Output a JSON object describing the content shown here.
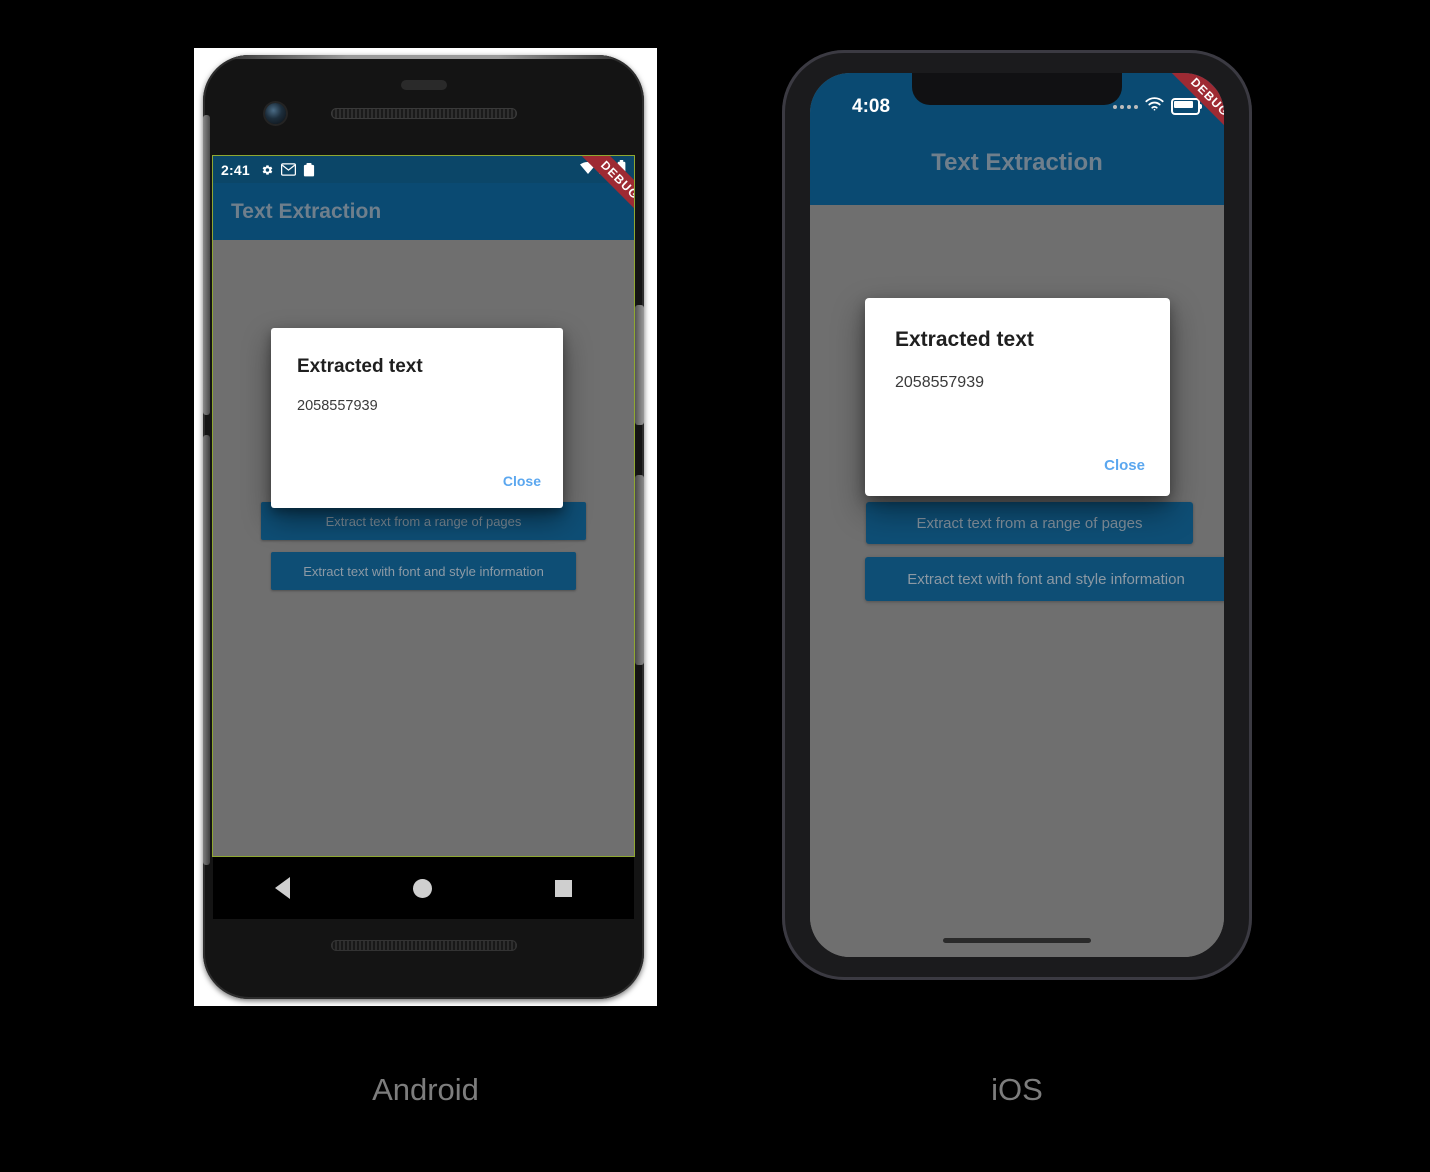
{
  "app": {
    "title": "Text Extraction",
    "debug_banner": "DEBUG",
    "accent_blue": "#0a4a72",
    "status_blue": "#0b4668",
    "body_gray": "#6f6f6f",
    "link_blue": "#5ba7ef",
    "ribbon_red": "#9e2a33"
  },
  "android": {
    "caption": "Android",
    "status_bar": {
      "time": "2:41",
      "icons": [
        "gear-icon",
        "mail-icon",
        "clipboard-icon"
      ],
      "right_icons": [
        "wifi-icon",
        "signal-icon",
        "battery-icon"
      ]
    },
    "appbar": {
      "title": "Text Extraction"
    },
    "buttons": [
      {
        "label": "Extract text from a range of pages"
      },
      {
        "label": "Extract text with font and style information"
      }
    ],
    "dialog": {
      "title": "Extracted text",
      "body": "2058557939",
      "close_label": "Close"
    },
    "navbar": {
      "back": "back-triangle-icon",
      "home": "home-circle-icon",
      "recents": "recents-square-icon"
    }
  },
  "ios": {
    "caption": "iOS",
    "status_bar": {
      "time": "4:08",
      "right_icons": [
        "cellular-dots-icon",
        "wifi-icon",
        "battery-icon"
      ]
    },
    "appbar": {
      "title": "Text Extraction"
    },
    "buttons": [
      {
        "label": "Extract text from a range of pages"
      },
      {
        "label": "Extract text with font and style information"
      }
    ],
    "dialog": {
      "title": "Extracted text",
      "body": "2058557939",
      "close_label": "Close"
    }
  }
}
